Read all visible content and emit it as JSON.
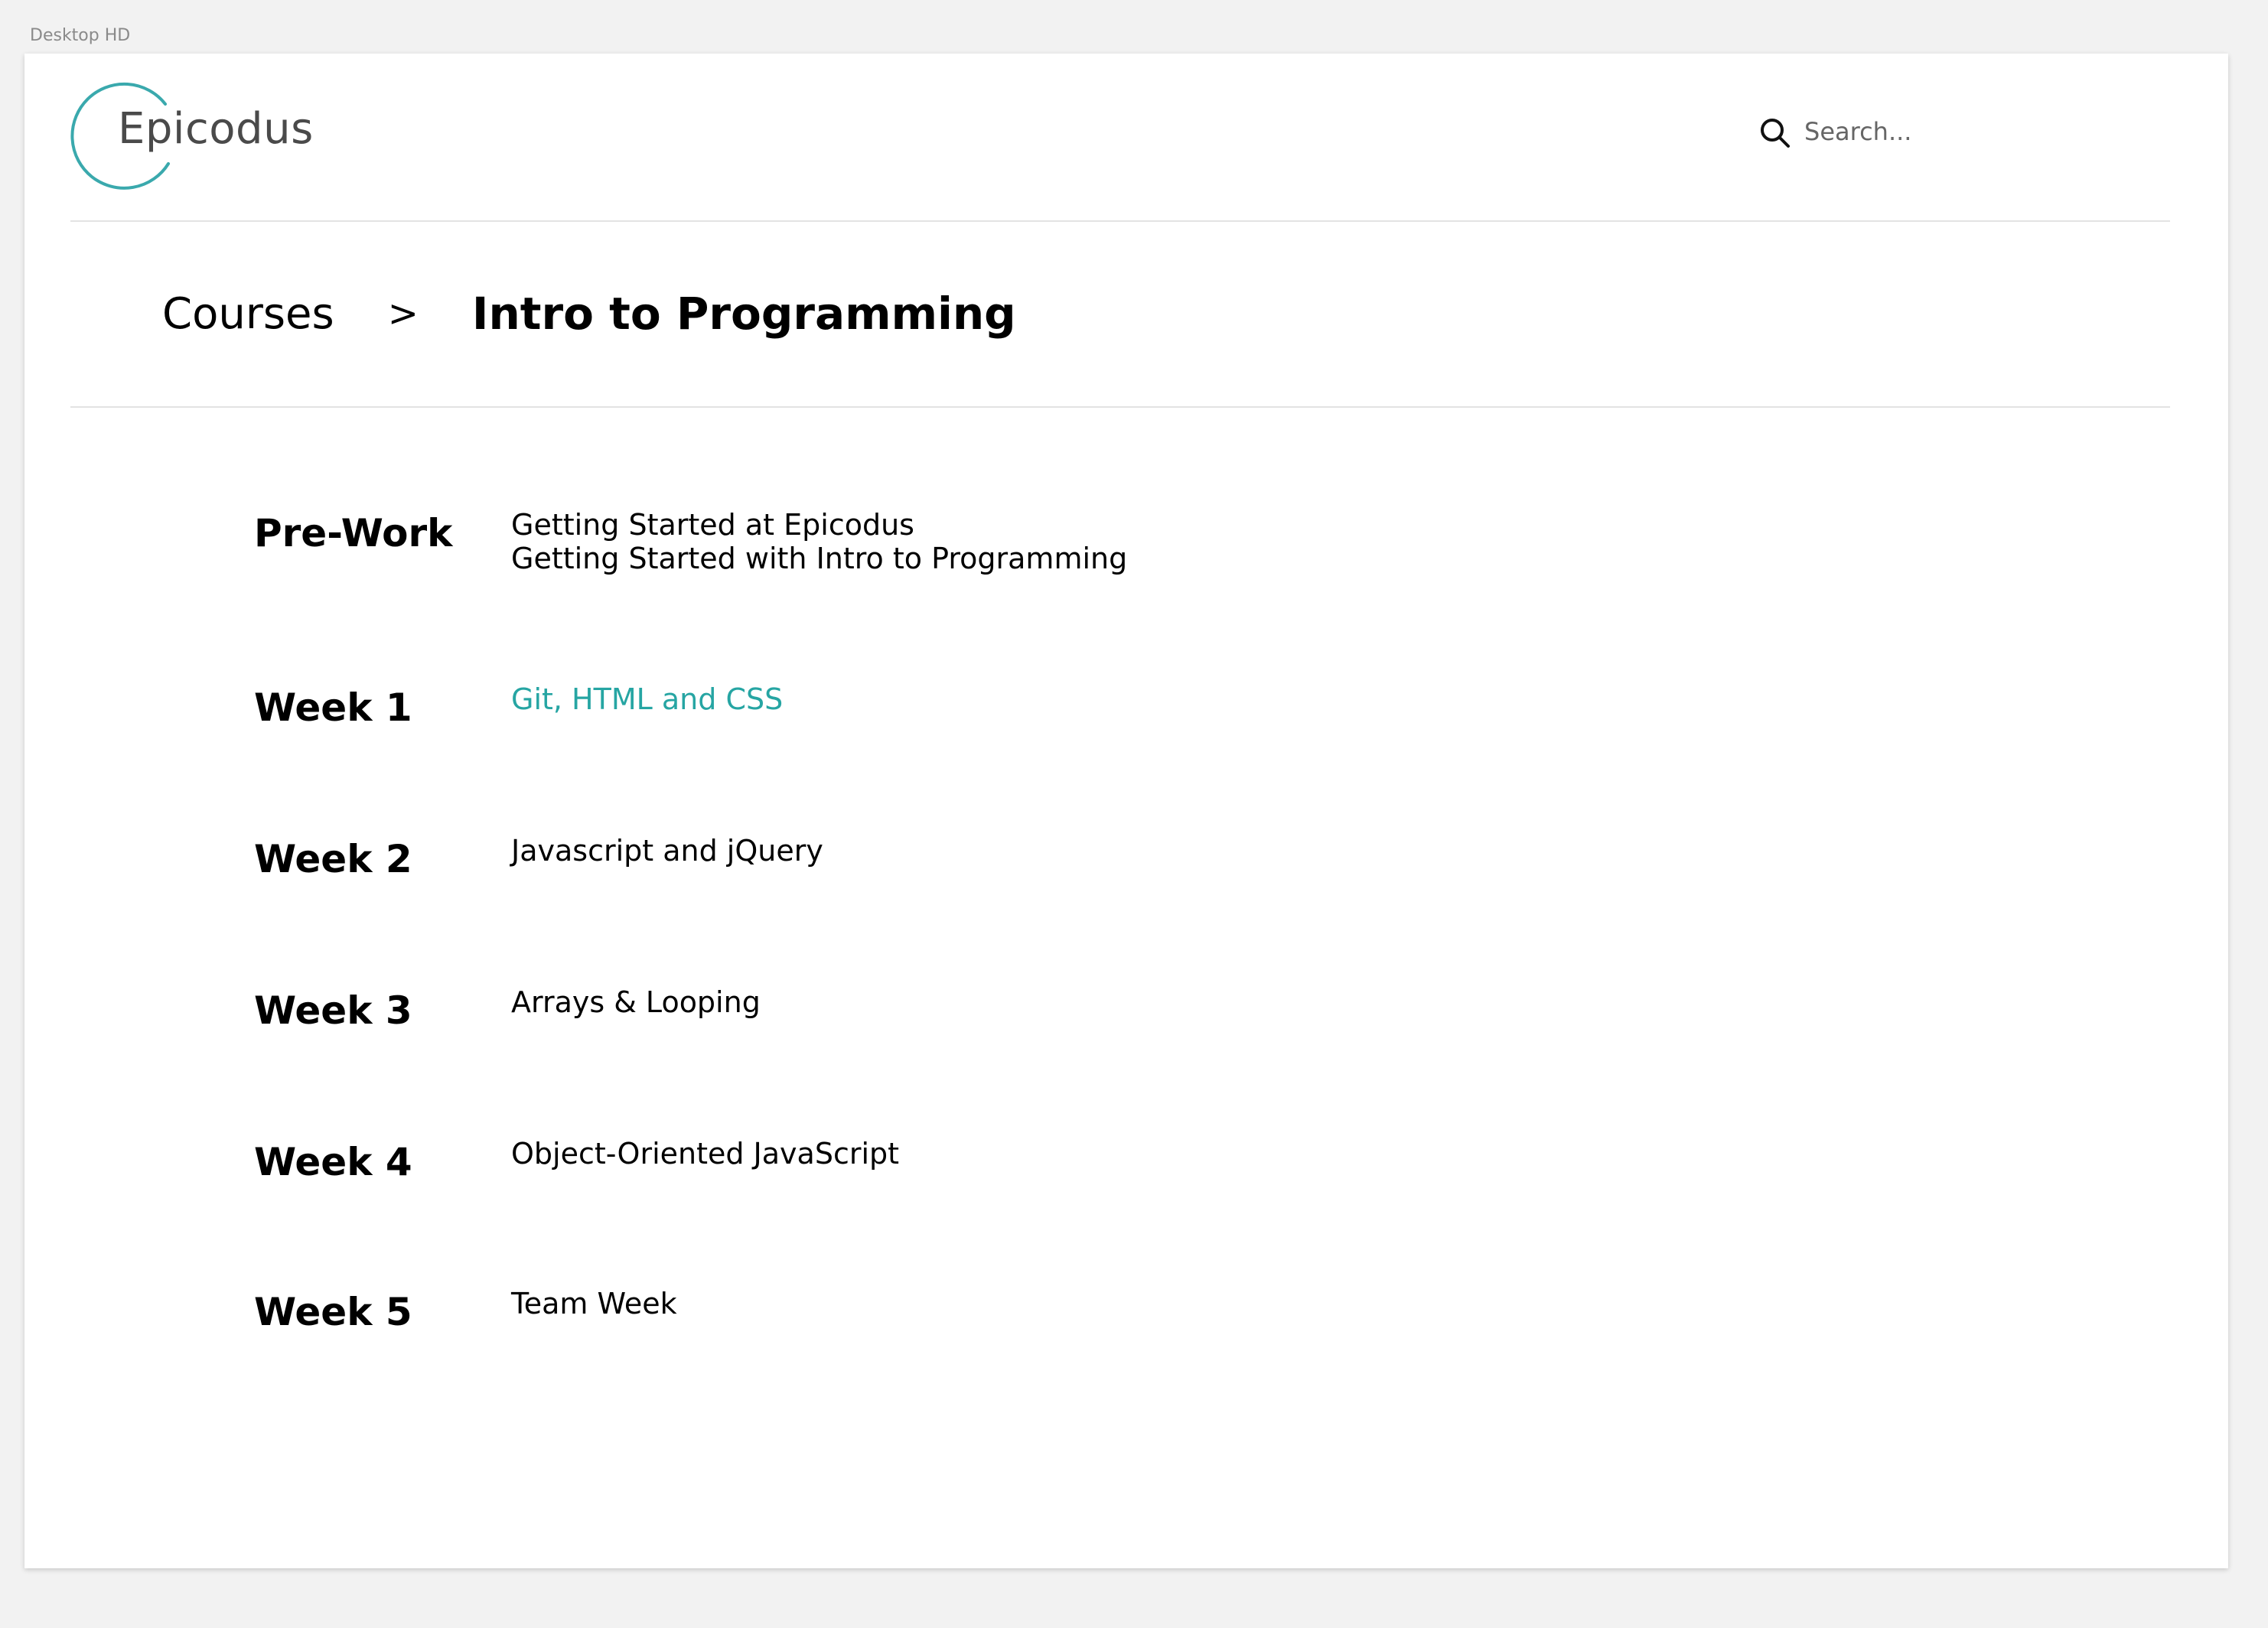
{
  "artboard": {
    "label": "Desktop HD"
  },
  "header": {
    "logo_text": "Epicodus",
    "brand_color": "#3aa9ad",
    "search": {
      "icon": "search-icon",
      "placeholder": "Search..."
    }
  },
  "breadcrumb": {
    "parent": "Courses",
    "separator": ">",
    "current": "Intro to Programming"
  },
  "weeks": [
    {
      "title": "Pre-Work",
      "lessons": [
        "Getting Started at Epicodus",
        "Getting Started with Intro to Programming"
      ]
    },
    {
      "title": "Week 1",
      "lessons": [
        "Git, HTML and CSS"
      ],
      "active_lesson": "Git, HTML and CSS",
      "active_color": "#26a5a3"
    },
    {
      "title": "Week 2",
      "lessons": [
        "Javascript and jQuery"
      ]
    },
    {
      "title": "Week 3",
      "lessons": [
        "Arrays & Looping"
      ]
    },
    {
      "title": "Week 4",
      "lessons": [
        "Object-Oriented JavaScript"
      ]
    },
    {
      "title": "Week 5",
      "lessons": [
        "Team Week"
      ]
    }
  ]
}
